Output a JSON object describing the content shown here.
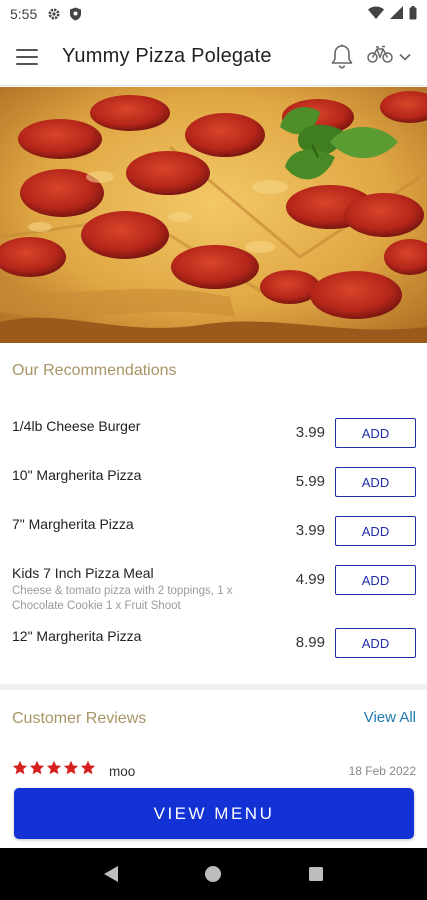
{
  "status_bar": {
    "time": "5:55",
    "icons": [
      "gear-icon",
      "shield-icon",
      "wifi-icon",
      "signal-icon",
      "battery-icon"
    ]
  },
  "app_bar": {
    "title": "Yummy Pizza Polegate",
    "icons": [
      "hamburger-menu-icon",
      "bell-icon",
      "bicycles-icon",
      "chevron-down-icon"
    ]
  },
  "hero": {
    "image": "pepperoni-pizza-with-basil"
  },
  "recommendations": {
    "title": "Our Recommendations",
    "add_label": "ADD",
    "items": [
      {
        "name": "1/4lb Cheese Burger",
        "price": "3.99",
        "description": ""
      },
      {
        "name": "10\" Margherita Pizza",
        "price": "5.99",
        "description": ""
      },
      {
        "name": "7\" Margherita Pizza",
        "price": "3.99",
        "description": ""
      },
      {
        "name": "Kids 7 Inch Pizza Meal",
        "price": "4.99",
        "description": "Cheese & tomato pizza with 2 toppings, 1 x Chocolate Cookie 1 x Fruit Shoot"
      },
      {
        "name": "12\" Margherita Pizza",
        "price": "8.99",
        "description": ""
      }
    ]
  },
  "reviews": {
    "title": "Customer Reviews",
    "view_all": "View All",
    "items": [
      {
        "stars": 5,
        "reviewer": "moo",
        "date": "18 Feb 2022"
      }
    ]
  },
  "cta": {
    "label": "VIEW MENU"
  },
  "nav_bar": {
    "icons": [
      "back-icon",
      "home-icon",
      "recents-icon"
    ]
  },
  "colors": {
    "primary_blue": "#1232d6",
    "add_border": "#1f2ea8",
    "section_title": "#a89566",
    "link": "#1f7ab0",
    "star": "#d62020"
  }
}
